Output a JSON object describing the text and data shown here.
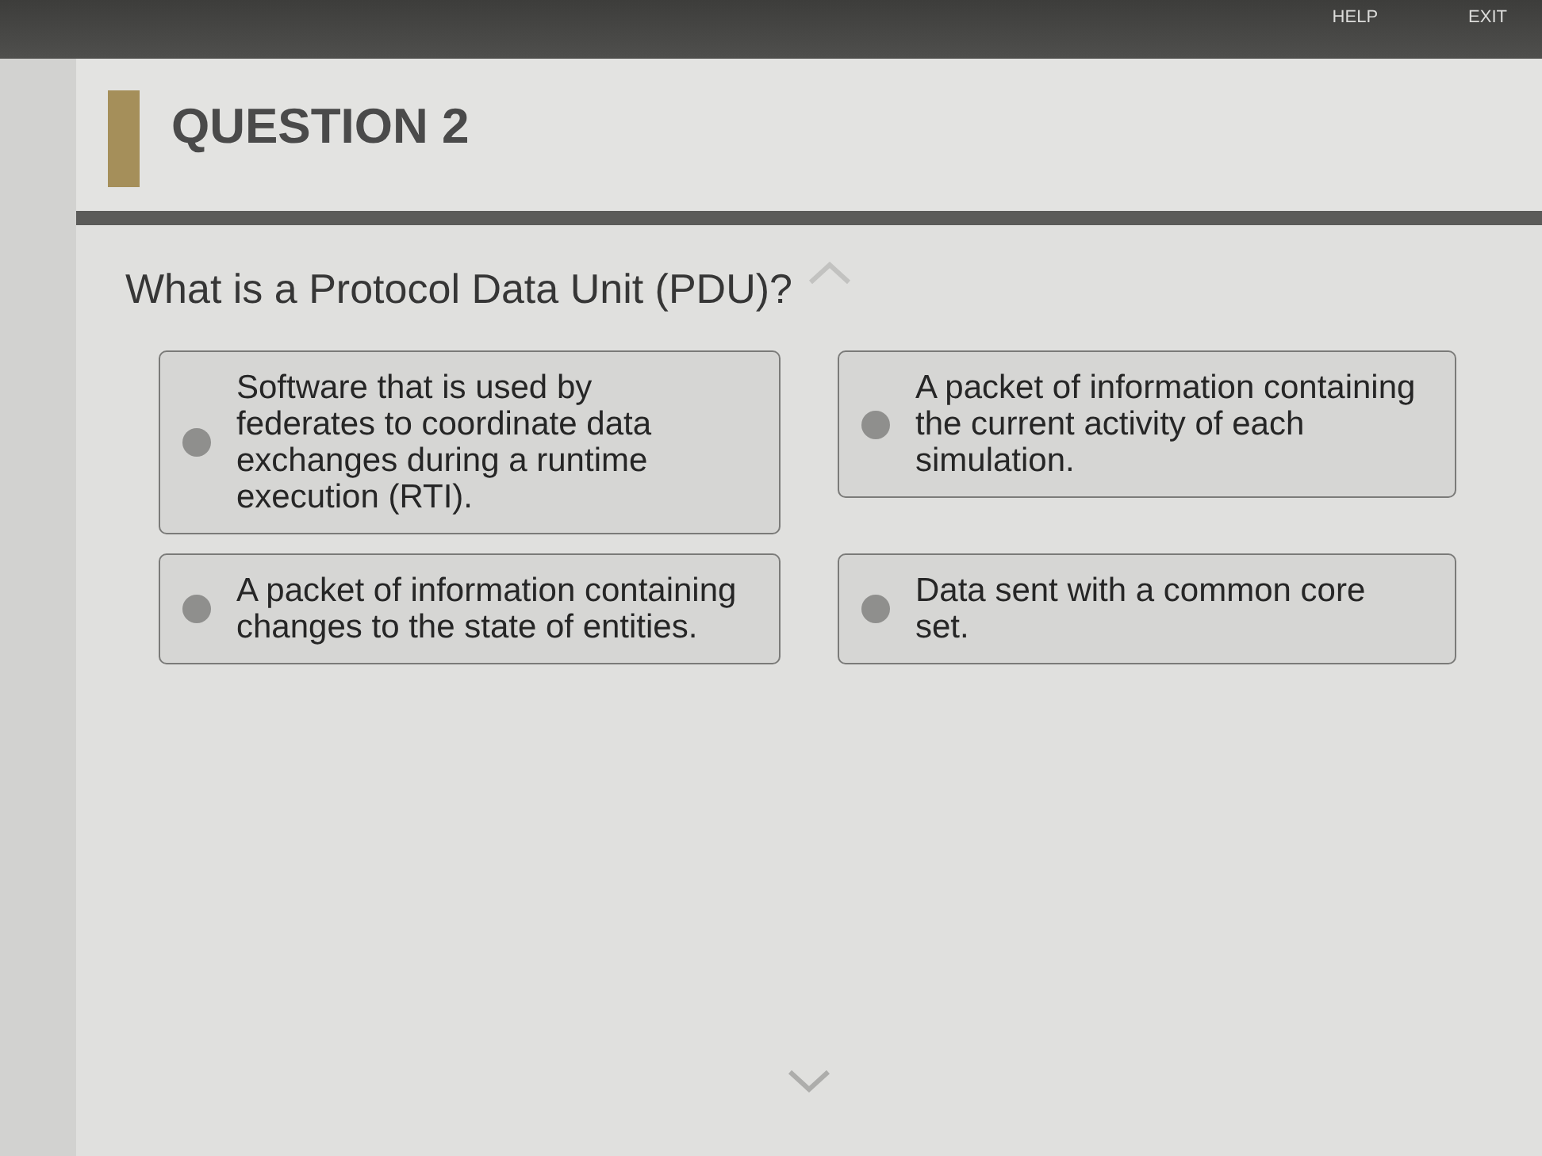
{
  "top_bar": {
    "buttons": [
      {
        "label": "HELP"
      },
      {
        "label": "EXIT"
      }
    ]
  },
  "question": {
    "title": "QUESTION 2",
    "text": "What is a Protocol Data Unit (PDU)?"
  },
  "options": [
    {
      "text": "Software that is used by federates to coordinate data exchanges during a runtime execution (RTI).",
      "selected": false
    },
    {
      "text": "A packet of information containing the current activity of each simulation.",
      "selected": false
    },
    {
      "text": "A packet of information containing changes to the state of entities.",
      "selected": false
    },
    {
      "text": "Data sent with a common core set.",
      "selected": false
    }
  ]
}
